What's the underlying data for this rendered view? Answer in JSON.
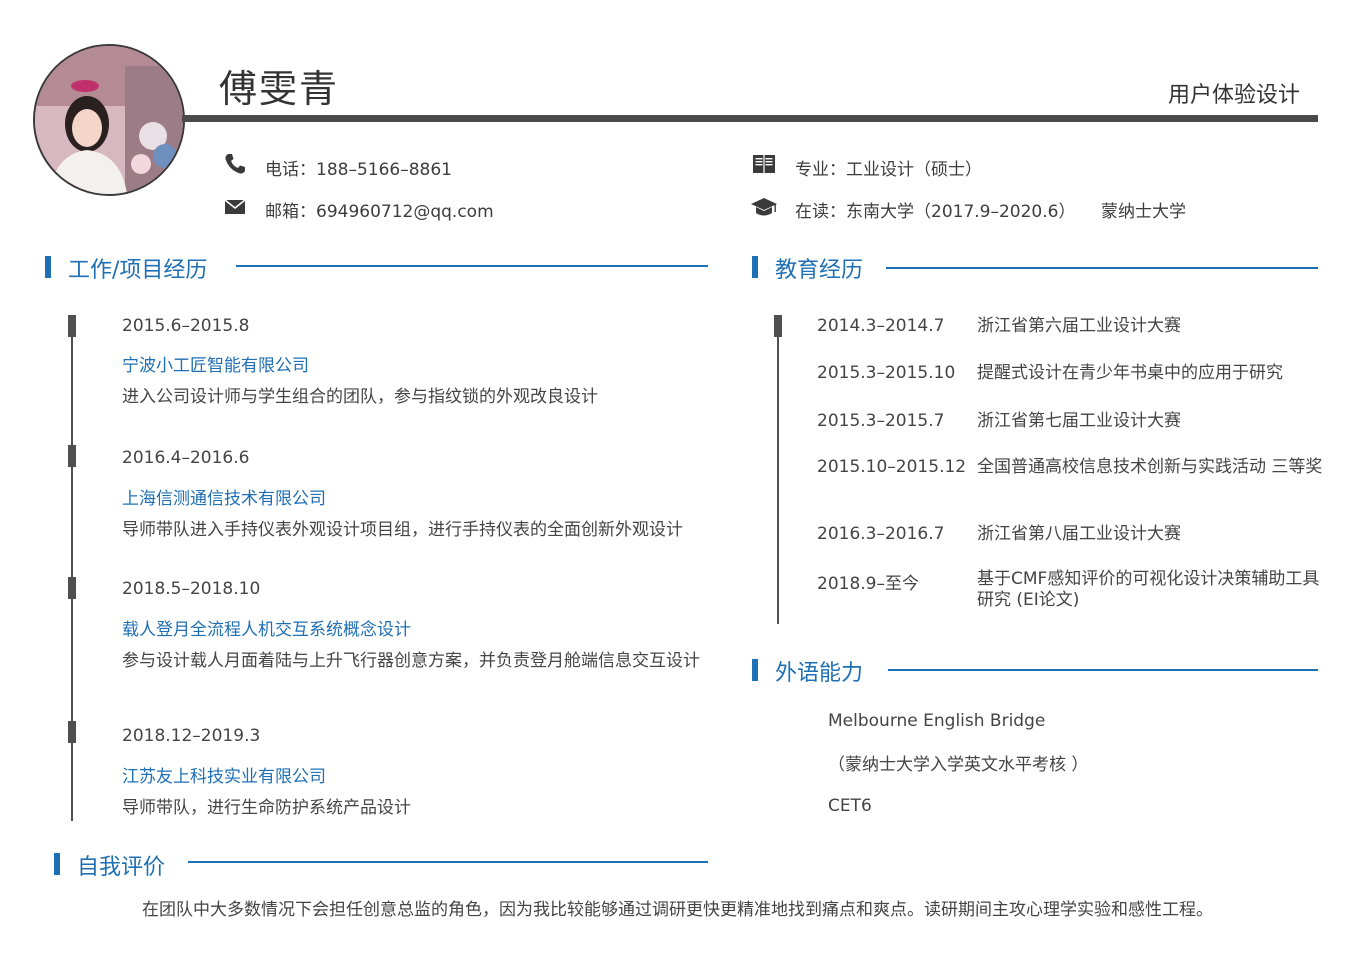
{
  "header": {
    "name": "傅雯青",
    "role": "用户体验设计"
  },
  "contact": {
    "phone": "电话：188–5166–8861",
    "email": "邮箱：694960712@qq.com",
    "major": "专业：工业设计（硕士）",
    "school": "在读：东南大学（2017.9–2020.6）",
    "school_extra": "蒙纳士大学"
  },
  "work": {
    "title": "工作/项目经历",
    "items": [
      {
        "date": "2015.6–2015.8",
        "org": "宁波小工匠智能有限公司",
        "desc": "进入公司设计师与学生组合的团队，参与指纹锁的外观改良设计"
      },
      {
        "date": "2016.4–2016.6",
        "org": "上海信测通信技术有限公司",
        "desc": "导师带队进入手持仪表外观设计项目组，进行手持仪表的全面创新外观设计"
      },
      {
        "date": "2018.5–2018.10",
        "org": "载人登月全流程人机交互系统概念设计",
        "desc": "参与设计载人月面着陆与上升飞行器创意方案，并负责登月舱端信息交互设计"
      },
      {
        "date": "2018.12–2019.3",
        "org": "江苏友上科技实业有限公司",
        "desc": "导师带队，进行生命防护系统产品设计"
      }
    ]
  },
  "education": {
    "title": "教育经历",
    "items": [
      {
        "date": "2014.3–2014.7",
        "desc": "浙江省第六届工业设计大赛"
      },
      {
        "date": "2015.3–2015.10",
        "desc": "提醒式设计在青少年书桌中的应用于研究"
      },
      {
        "date": "2015.3–2015.7",
        "desc": "浙江省第七届工业设计大赛"
      },
      {
        "date": "2015.10–2015.12",
        "desc": "全国普通高校信息技术创新与实践活动  三等奖"
      },
      {
        "date": "2016.3–2016.7",
        "desc": "浙江省第八届工业设计大赛"
      },
      {
        "date": "2018.9–至今",
        "desc": "基于CMF感知评价的可视化设计决策辅助工具研究 (EI论文)"
      }
    ]
  },
  "language": {
    "title": "外语能力",
    "line1": "Melbourne English Bridge",
    "line2": "（蒙纳士大学入学英文水平考核    ）",
    "line3": "CET6"
  },
  "self": {
    "title": "自我评价",
    "text": "在团队中大多数情况下会担任创意总监的角色，因为我比较能够通过调研更快更精准地找到痛点和爽点。读研期间主攻心理学实验和感性工程。"
  },
  "icons": {
    "phone": "phone-icon",
    "email": "envelope-icon",
    "major": "book-icon",
    "school": "graduation-cap-icon"
  },
  "colors": {
    "accent": "#1f6fb5",
    "dark": "#4a4a4a"
  }
}
